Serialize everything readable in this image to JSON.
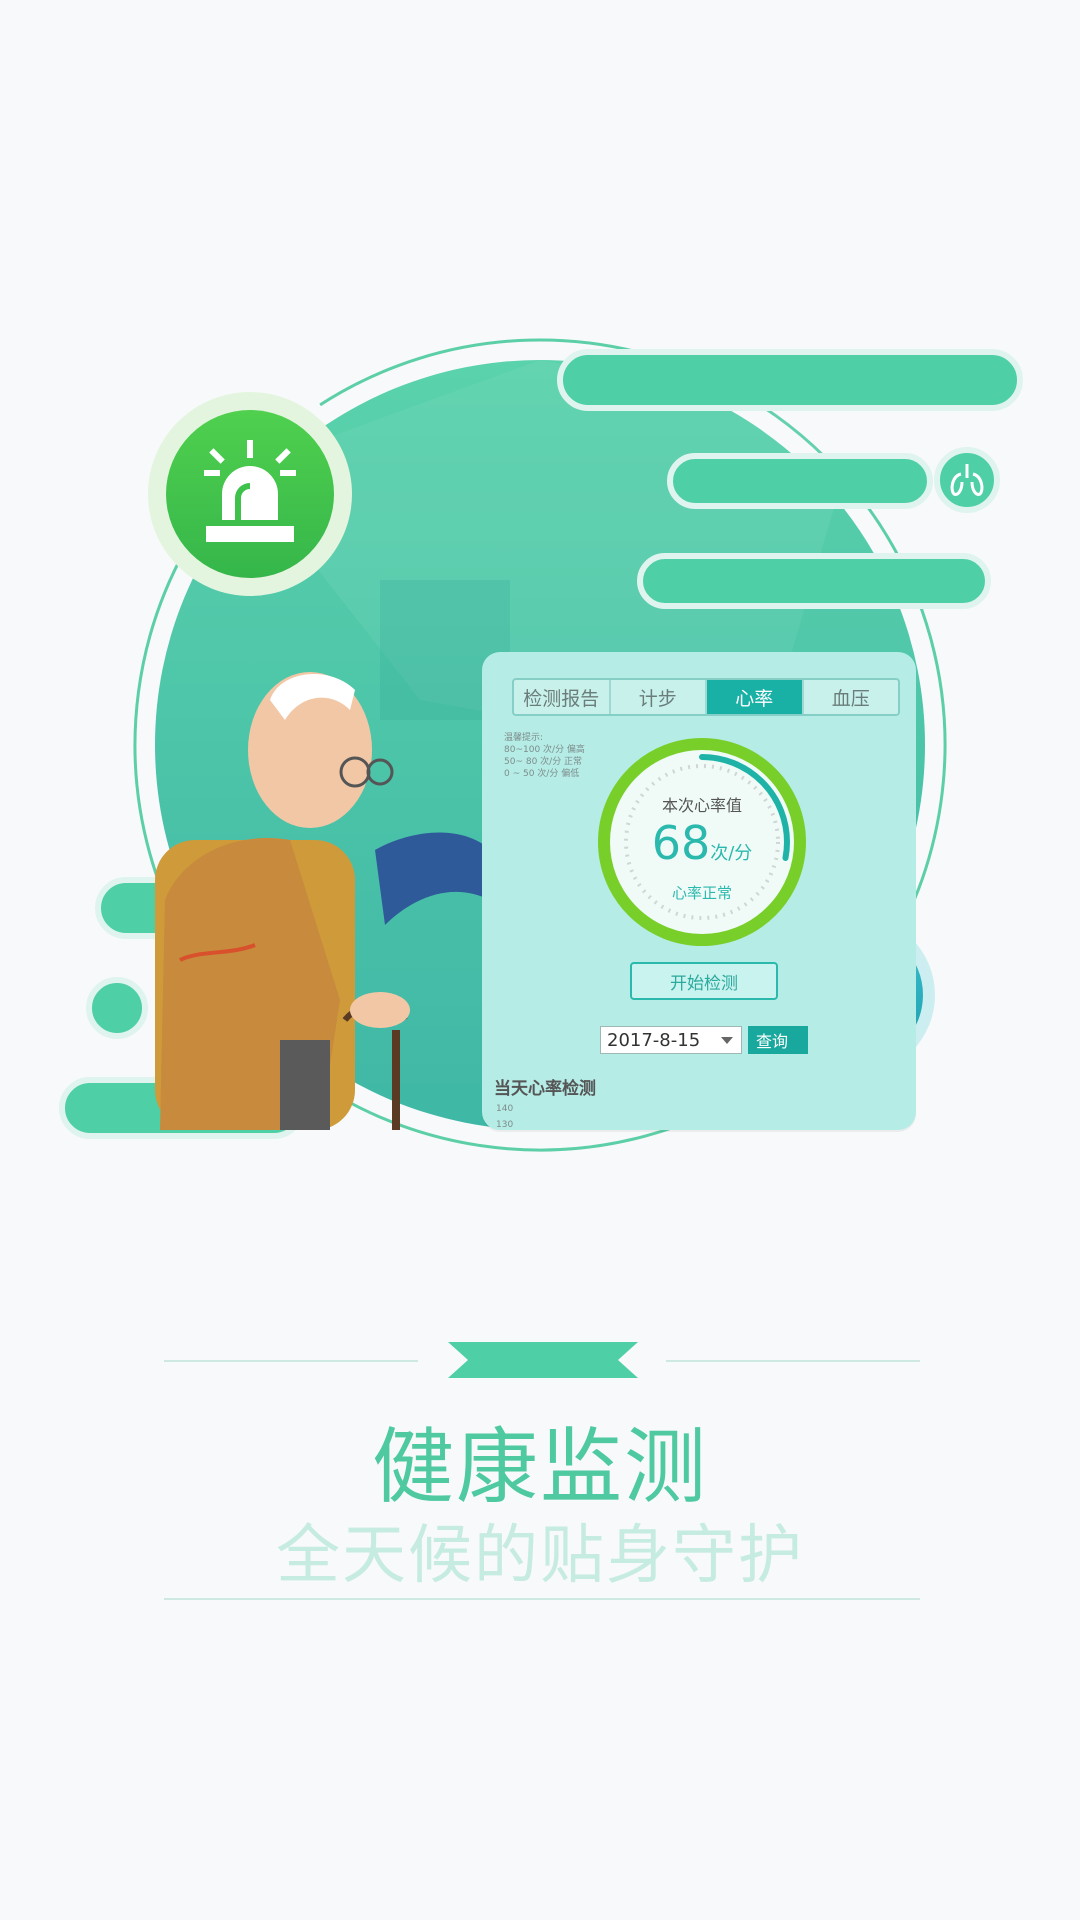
{
  "hero": {
    "icons": {
      "alarm": "alarm-siren-icon",
      "lungs": "lungs-icon",
      "bed": "bed-icon"
    },
    "colors": {
      "primary_teal": "#4ecfa6",
      "alarm_green": "#3fc24c",
      "bed_teal": "#20a9b5"
    }
  },
  "card": {
    "tabs": [
      {
        "label": "检测报告"
      },
      {
        "label": "计步"
      },
      {
        "label": "心率"
      },
      {
        "label": "血压"
      }
    ],
    "active_tab": "心率",
    "legend": {
      "title": "温馨提示:",
      "rows": [
        "80~100  次/分  偏高",
        "50~ 80  次/分  正常",
        " 0 ~ 50  次/分  偏低"
      ]
    },
    "gauge": {
      "title": "本次心率值",
      "value": "68",
      "unit": "次/分",
      "status": "心率正常",
      "progress": 0.28
    },
    "start_button": "开始检测",
    "date": "2017-8-15",
    "query_button": "查询",
    "chart_title": "当天心率检测",
    "y_ticks": [
      "140",
      "130"
    ]
  },
  "headline": {
    "title": "健康监测",
    "subtitle": "全天候的贴身守护"
  }
}
